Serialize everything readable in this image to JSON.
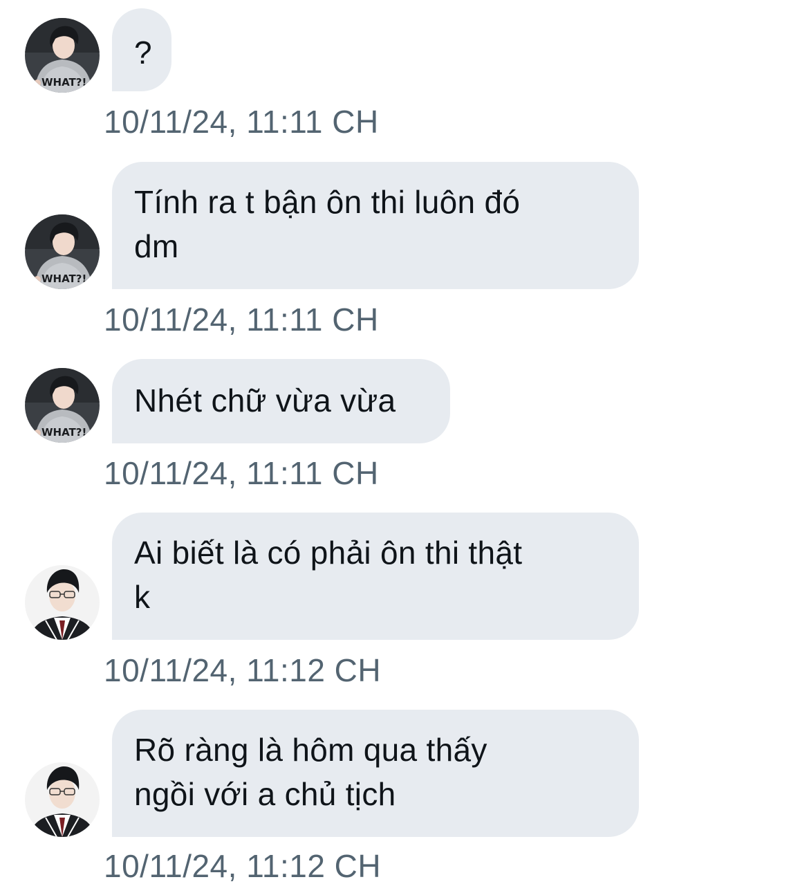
{
  "messages": [
    {
      "sender": "contact-a",
      "text": "?",
      "timestamp": "10/11/24, 11:11 CH"
    },
    {
      "sender": "contact-a",
      "text": "Tính ra t bận ôn thi luôn đó\ndm",
      "timestamp": "10/11/24, 11:11 CH"
    },
    {
      "sender": "contact-a",
      "text": "Nhét chữ vừa vừa",
      "timestamp": "10/11/24, 11:11 CH"
    },
    {
      "sender": "contact-b",
      "text": "Ai biết là có phải ôn thi thật\nk",
      "timestamp": "10/11/24, 11:12 CH"
    },
    {
      "sender": "contact-b",
      "text": "Rõ ràng là hôm qua thấy\nngồi với a chủ tịch",
      "timestamp": "10/11/24, 11:12 CH"
    }
  ],
  "avatars": {
    "contact-a": {
      "hoodie_text": "WHAT?!",
      "icon": "user-avatar-photo"
    },
    "contact-b": {
      "icon": "user-avatar-photo"
    }
  },
  "colors": {
    "bubble_bg": "#e7ebf0",
    "text": "#0f1419",
    "timestamp": "#536471"
  }
}
